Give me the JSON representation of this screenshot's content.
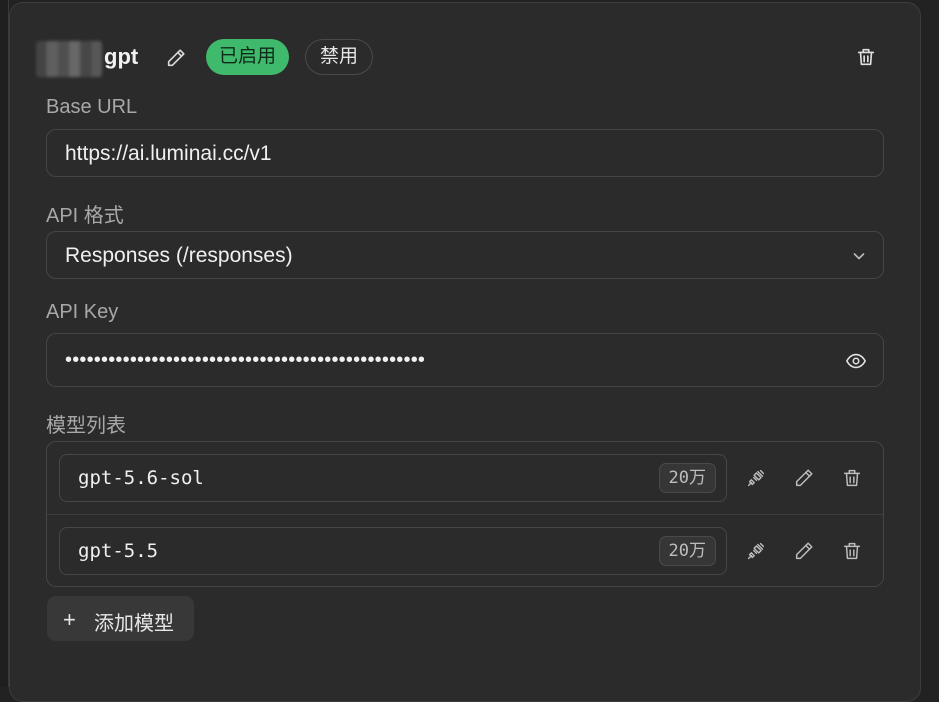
{
  "provider": {
    "name": "gpt",
    "enabled_label": "已启用",
    "disable_label": "禁用"
  },
  "base_url": {
    "label": "Base URL",
    "value": "https://ai.luminai.cc/v1"
  },
  "api_format": {
    "label": "API 格式",
    "selected": "Responses (/responses)"
  },
  "api_key": {
    "label": "API Key",
    "masked_value": "••••••••••••••••••••••••••••••••••••••••••••••••••"
  },
  "models": {
    "label": "模型列表",
    "items": [
      {
        "name": "gpt-5.6-sol",
        "context": "20万"
      },
      {
        "name": "gpt-5.5",
        "context": "20万"
      }
    ],
    "add_label": "添加模型",
    "add_symbol": "+"
  },
  "colors": {
    "enabled_badge": "#3fb96c",
    "background": "#2b2b2b",
    "border": "#454545"
  },
  "icons": [
    "pencil-icon",
    "trash-icon",
    "chevron-down-icon",
    "eye-icon",
    "plug-icon",
    "plus-icon"
  ]
}
